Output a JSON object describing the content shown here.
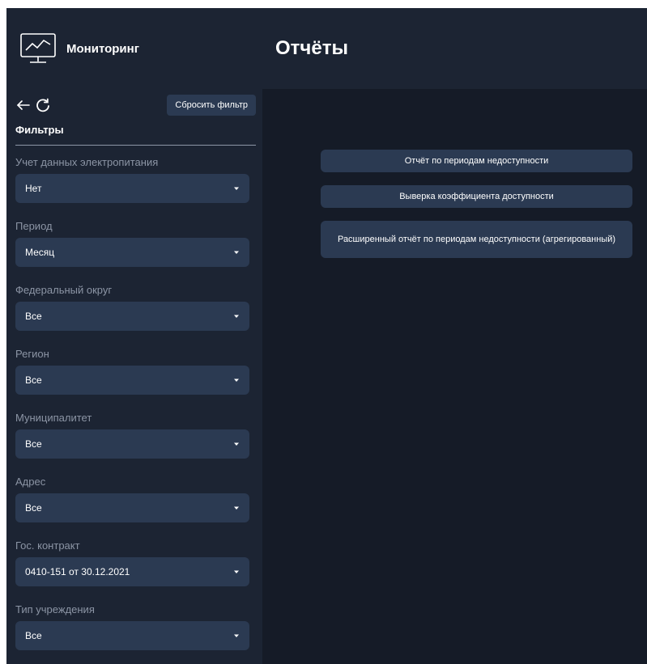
{
  "brand": {
    "name": "Мониторинг",
    "icon": "monitor-chart-icon"
  },
  "header": {
    "title": "Отчёты"
  },
  "sidebar": {
    "nav": {
      "back_icon": "arrow-left-icon",
      "refresh_icon": "refresh-icon"
    },
    "reset_label": "Сбросить фильтр",
    "filters_title": "Фильтры",
    "filters": [
      {
        "label": "Учет данных электропитания",
        "value": "Нет"
      },
      {
        "label": "Период",
        "value": "Месяц"
      },
      {
        "label": "Федеральный округ",
        "value": "Все"
      },
      {
        "label": "Регион",
        "value": "Все"
      },
      {
        "label": "Муниципалитет",
        "value": "Все"
      },
      {
        "label": "Адрес",
        "value": "Все"
      },
      {
        "label": "Гос. контракт",
        "value": "0410-151 от 30.12.2021"
      },
      {
        "label": "Тип учреждения",
        "value": "Все"
      }
    ]
  },
  "main": {
    "reports": [
      {
        "label": "Отчёт по периодам недоступности"
      },
      {
        "label": "Выверка коэффициента доступности"
      },
      {
        "label": "Расширенный отчёт по периодам недоступности (агрегированный)"
      }
    ]
  },
  "colors": {
    "background": "#151b27",
    "panel": "#1c2433",
    "control": "#2b3a52",
    "label": "#8c95a5",
    "text": "#ffffff"
  }
}
